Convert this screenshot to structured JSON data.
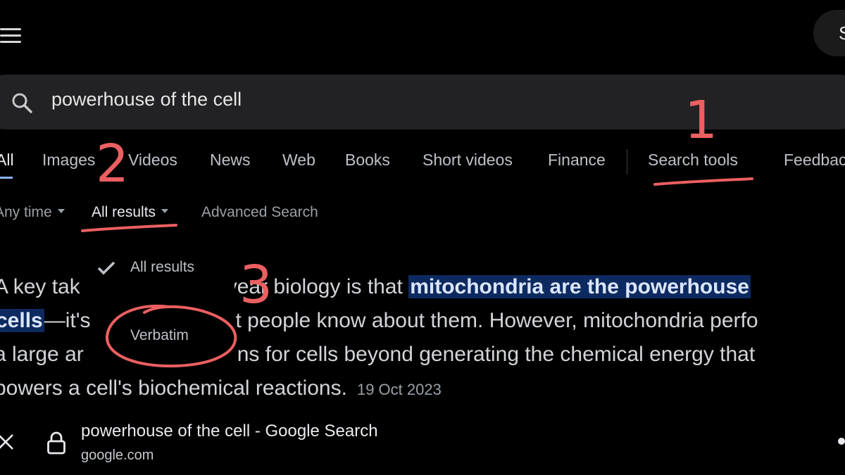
{
  "header": {
    "menu_icon": "hamburger-menu-icon",
    "signin_partial": "S"
  },
  "search": {
    "query": "powerhouse of the cell",
    "icon": "search-icon"
  },
  "tabs": [
    {
      "label": "All",
      "active": true
    },
    {
      "label": "Images"
    },
    {
      "label": "Videos"
    },
    {
      "label": "News"
    },
    {
      "label": "Web"
    },
    {
      "label": "Books"
    },
    {
      "label": "Short videos"
    },
    {
      "label": "Finance"
    },
    {
      "label": "Search tools"
    },
    {
      "label": "Feedback"
    }
  ],
  "filters": {
    "time": "Any time",
    "results": "All results",
    "advanced": "Advanced Search"
  },
  "results_dropdown": {
    "items": [
      "All results",
      "Verbatim"
    ],
    "checked": "All results"
  },
  "snippet": {
    "line1_a": "A key tak",
    "line1_b": "s-year biology is that ",
    "line1_hl": "mitochondria are the powerhouse",
    "line2_hl": "cells",
    "line2_a": "—it's",
    "line2_b": "t people know about them. However, mitochondria perfo",
    "line3_a": "a large ar",
    "line3_b": "ns for cells beyond generating the chemical energy that",
    "line4": "powers a cell's biochemical reactions.",
    "date": "19 Oct 2023"
  },
  "annotations": {
    "n1": "1",
    "n2": "2",
    "n3": "3",
    "color": "#ec5f61"
  },
  "bottom_bar": {
    "title": "powerhouse of the cell - Google Search",
    "domain": "google.com",
    "close_icon": "close-icon",
    "lock_icon": "lock-icon"
  },
  "colors": {
    "background": "#000000",
    "highlight": "#0d2a60",
    "search_box": "#222224"
  }
}
